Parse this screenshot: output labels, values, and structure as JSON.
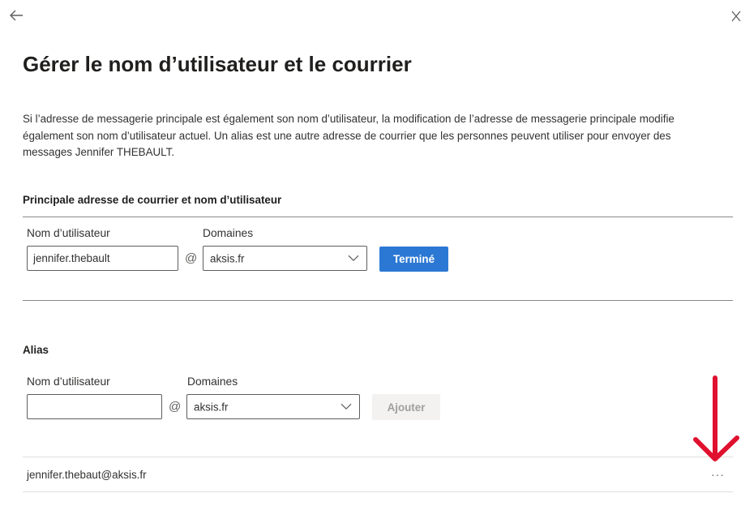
{
  "title": "Gérer le nom d’utilisateur et le courrier",
  "description": "Si l’adresse de messagerie principale est également son nom d’utilisateur, la modification de l’adresse de messagerie principale modifie également son nom d’utilisateur actuel. Un alias est une autre adresse de courrier que les personnes peuvent utiliser pour envoyer des messages Jennifer THEBAULT.",
  "primary": {
    "section_title": "Principale adresse de courrier et nom d’utilisateur",
    "username_label": "Nom d’utilisateur",
    "username_value": "jennifer.thebault",
    "at": "@",
    "domain_label": "Domaines",
    "domain_value": "aksis.fr",
    "done_label": "Terminé"
  },
  "alias": {
    "section_title": "Alias",
    "username_label": "Nom d’utilisateur",
    "username_value": "",
    "at": "@",
    "domain_label": "Domaines",
    "domain_value": "aksis.fr",
    "add_label": "Ajouter",
    "items": [
      {
        "email": "jennifer.thebaut@aksis.fr",
        "more": "···"
      }
    ]
  },
  "icons": {
    "back": "arrow-left-icon",
    "close": "close-icon",
    "chevron": "chevron-down-icon",
    "annotation": "red-arrow-down-icon"
  },
  "colors": {
    "primary_button": "#2b78d4",
    "annotation_arrow": "#e0102f",
    "disabled_button": "#f3f2f1"
  }
}
